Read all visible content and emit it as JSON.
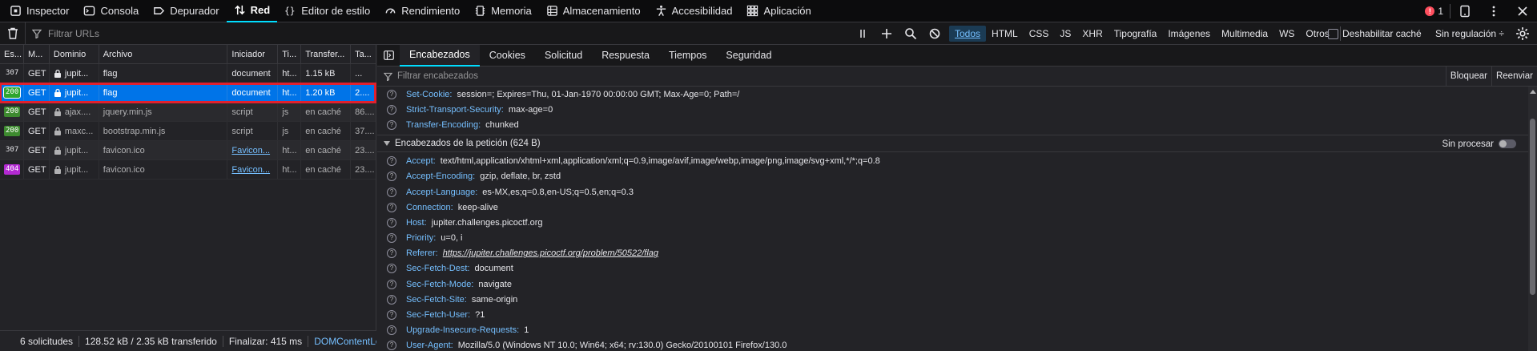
{
  "toolbar": {
    "tabs": [
      {
        "label": "Inspector",
        "icon": "inspector-icon",
        "active": false
      },
      {
        "label": "Consola",
        "icon": "console-icon",
        "active": false
      },
      {
        "label": "Depurador",
        "icon": "debugger-icon",
        "active": false
      },
      {
        "label": "Red",
        "icon": "network-icon",
        "active": true
      },
      {
        "label": "Editor de estilo",
        "icon": "style-editor-icon",
        "active": false
      },
      {
        "label": "Rendimiento",
        "icon": "performance-icon",
        "active": false
      },
      {
        "label": "Memoria",
        "icon": "memory-icon",
        "active": false
      },
      {
        "label": "Almacenamiento",
        "icon": "storage-icon",
        "active": false
      },
      {
        "label": "Accesibilidad",
        "icon": "accessibility-icon",
        "active": false
      },
      {
        "label": "Aplicación",
        "icon": "application-icon",
        "active": false
      }
    ],
    "error_count": "1"
  },
  "filterbar": {
    "url_placeholder": "Filtrar URLs",
    "types": [
      "Todos",
      "HTML",
      "CSS",
      "JS",
      "XHR",
      "Tipografía",
      "Imágenes",
      "Multimedia",
      "WS",
      "Otros"
    ],
    "active_type": "Todos",
    "disable_cache": "Deshabilitar caché",
    "throttle": "Sin regulación ÷"
  },
  "requests": {
    "headers": [
      "Es...",
      "M...",
      "Dominio",
      "Archivo",
      "Iniciador",
      "Ti...",
      "Transfer...",
      "Ta..."
    ],
    "rows": [
      {
        "status": "307",
        "method": "GET",
        "domain": "jupit...",
        "file": "flag",
        "initiator": "document",
        "type": "ht...",
        "transferred": "1.15 kB",
        "size": "..."
      },
      {
        "status": "200",
        "method": "GET",
        "domain": "jupit...",
        "file": "flag",
        "initiator": "document",
        "type": "ht...",
        "transferred": "1.20 kB",
        "size": "2...."
      },
      {
        "status": "200",
        "method": "GET",
        "domain": "ajax....",
        "file": "jquery.min.js",
        "initiator": "script",
        "type": "js",
        "transferred": "en caché",
        "size": "86...."
      },
      {
        "status": "200",
        "method": "GET",
        "domain": "maxc...",
        "file": "bootstrap.min.js",
        "initiator": "script",
        "type": "js",
        "transferred": "en caché",
        "size": "37...."
      },
      {
        "status": "307",
        "method": "GET",
        "domain": "jupit...",
        "file": "favicon.ico",
        "initiator": "Favicon...",
        "type": "ht...",
        "transferred": "en caché",
        "size": "23...."
      },
      {
        "status": "404",
        "method": "GET",
        "domain": "jupit...",
        "file": "favicon.ico",
        "initiator": "Favicon...",
        "type": "ht...",
        "transferred": "en caché",
        "size": "23...."
      }
    ]
  },
  "statusbar": {
    "requests": "6 solicitudes",
    "transferred": "128.52 kB / 2.35 kB transferido",
    "finish": "Finalizar: 415 ms",
    "dom": "DOMContentLoaded"
  },
  "details": {
    "tabs": [
      "Encabezados",
      "Cookies",
      "Solicitud",
      "Respuesta",
      "Tiempos",
      "Seguridad"
    ],
    "active_tab": "Encabezados",
    "filter_placeholder": "Filtrar encabezados",
    "block": "Bloquear",
    "resend": "Reenviar",
    "response_tail": [
      {
        "name": "Set-Cookie:",
        "value": "session=; Expires=Thu, 01-Jan-1970 00:00:00 GMT; Max-Age=0; Path=/"
      },
      {
        "name": "Strict-Transport-Security:",
        "value": "max-age=0"
      },
      {
        "name": "Transfer-Encoding:",
        "value": "chunked"
      }
    ],
    "request_section": "Encabezados de la petición (624 B)",
    "raw_toggle": "Sin procesar",
    "request_headers": [
      {
        "name": "Accept:",
        "value": "text/html,application/xhtml+xml,application/xml;q=0.9,image/avif,image/webp,image/png,image/svg+xml,*/*;q=0.8"
      },
      {
        "name": "Accept-Encoding:",
        "value": "gzip, deflate, br, zstd"
      },
      {
        "name": "Accept-Language:",
        "value": "es-MX,es;q=0.8,en-US;q=0.5,en;q=0.3"
      },
      {
        "name": "Connection:",
        "value": "keep-alive"
      },
      {
        "name": "Host:",
        "value": "jupiter.challenges.picoctf.org"
      },
      {
        "name": "Priority:",
        "value": "u=0, i"
      },
      {
        "name": "Referer:",
        "value": "https://jupiter.challenges.picoctf.org/problem/50522/flag"
      },
      {
        "name": "Sec-Fetch-Dest:",
        "value": "document"
      },
      {
        "name": "Sec-Fetch-Mode:",
        "value": "navigate"
      },
      {
        "name": "Sec-Fetch-Site:",
        "value": "same-origin"
      },
      {
        "name": "Sec-Fetch-User:",
        "value": "?1"
      },
      {
        "name": "Upgrade-Insecure-Requests:",
        "value": "1"
      },
      {
        "name": "User-Agent:",
        "value": "Mozilla/5.0 (Windows NT 10.0; Win64; x64; rv:130.0) Gecko/20100101 Firefox/130.0"
      }
    ]
  }
}
